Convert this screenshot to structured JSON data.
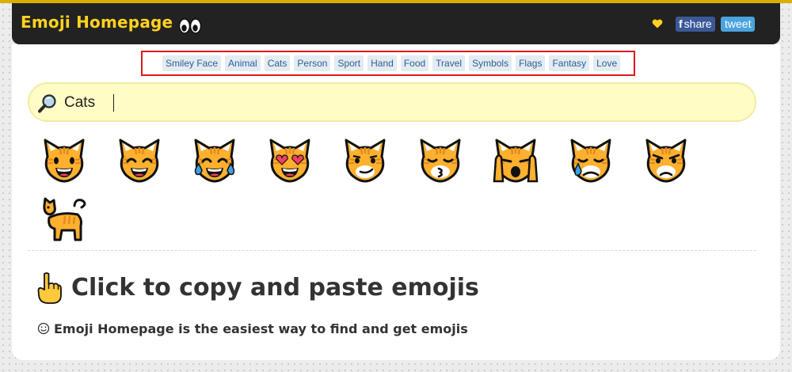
{
  "header": {
    "logo": "Emoji Homepage",
    "share_f": "f",
    "share_label": "share",
    "tweet_label": "tweet"
  },
  "categories": [
    "Smiley Face",
    "Animal",
    "Cats",
    "Person",
    "Sport",
    "Hand",
    "Food",
    "Travel",
    "Symbols",
    "Flags",
    "Fantasy",
    "Love"
  ],
  "search": {
    "value": "Cats",
    "icon": "magnifying-glass-icon"
  },
  "results": [
    "grinning-cat",
    "grinning-cat-with-smiling-eyes",
    "cat-with-tears-of-joy",
    "smiling-cat-with-heart-eyes",
    "cat-with-wry-smile",
    "kissing-cat",
    "weary-cat",
    "crying-cat",
    "pouting-cat",
    "cat"
  ],
  "intro": {
    "headline": "Click to copy and paste emojis",
    "subline": "Emoji Homepage is the easiest way to find and get emojis"
  },
  "colors": {
    "accent": "#ffd21f",
    "header_bg": "#222222",
    "highlight_border": "#e01818",
    "search_bg": "#fffcc6"
  }
}
